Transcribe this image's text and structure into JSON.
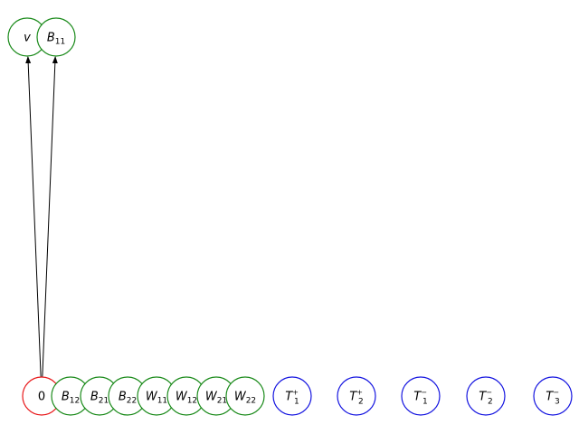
{
  "colors": {
    "red": "#e8191b",
    "green": "#1a8a1a",
    "blue": "#1515e0",
    "edge": "#000000"
  },
  "nodes": [
    {
      "id": "v",
      "main": "v",
      "sub": "",
      "sup": "",
      "color": "green"
    },
    {
      "id": "B11",
      "main": "B",
      "sub": "11",
      "sup": "",
      "color": "green"
    },
    {
      "id": "0",
      "main": "0",
      "sub": "",
      "sup": "",
      "color": "red",
      "plain": true
    },
    {
      "id": "B12",
      "main": "B",
      "sub": "12",
      "sup": "",
      "color": "green"
    },
    {
      "id": "B21",
      "main": "B",
      "sub": "21",
      "sup": "",
      "color": "green"
    },
    {
      "id": "B22",
      "main": "B",
      "sub": "22",
      "sup": "",
      "color": "green"
    },
    {
      "id": "W11",
      "main": "W",
      "sub": "11",
      "sup": "",
      "color": "green"
    },
    {
      "id": "W12",
      "main": "W",
      "sub": "12",
      "sup": "",
      "color": "green"
    },
    {
      "id": "W21",
      "main": "W",
      "sub": "21",
      "sup": "",
      "color": "green"
    },
    {
      "id": "W22",
      "main": "W",
      "sub": "22",
      "sup": "",
      "color": "green"
    },
    {
      "id": "T1p",
      "main": "T",
      "sub": "1",
      "sup": "+",
      "color": "blue"
    },
    {
      "id": "T2p",
      "main": "T",
      "sub": "2",
      "sup": "+",
      "color": "blue"
    },
    {
      "id": "T1m",
      "main": "T",
      "sub": "1",
      "sup": "−",
      "color": "blue"
    },
    {
      "id": "T2m",
      "main": "T",
      "sub": "2",
      "sup": "−",
      "color": "blue"
    },
    {
      "id": "T3m",
      "main": "T",
      "sub": "3",
      "sup": "−",
      "color": "blue"
    }
  ],
  "edges": [
    {
      "from": "0",
      "to": "v"
    },
    {
      "from": "0",
      "to": "B11"
    }
  ]
}
